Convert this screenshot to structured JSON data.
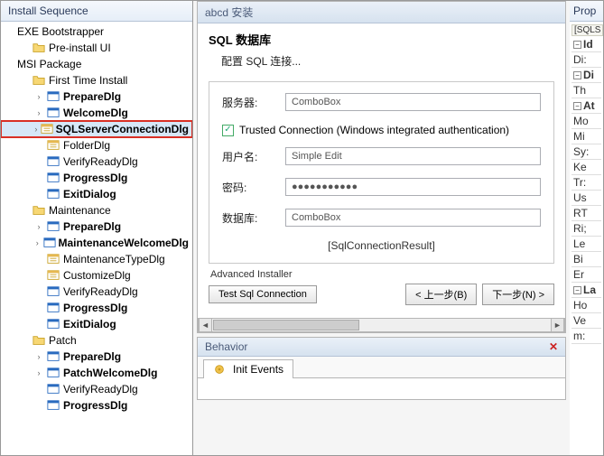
{
  "left": {
    "title": "Install Sequence",
    "tree": [
      {
        "d": 0,
        "exp": "",
        "icon": "root",
        "label": "EXE Bootstrapper",
        "bold": false
      },
      {
        "d": 1,
        "exp": "",
        "icon": "folder",
        "label": "Pre-install UI",
        "bold": false
      },
      {
        "d": 0,
        "exp": "",
        "icon": "root",
        "label": "MSI Package",
        "bold": false
      },
      {
        "d": 1,
        "exp": "",
        "icon": "folder",
        "label": "First Time Install",
        "bold": false
      },
      {
        "d": 2,
        "exp": "›",
        "icon": "dlg",
        "label": "PrepareDlg",
        "bold": true
      },
      {
        "d": 2,
        "exp": "›",
        "icon": "dlg",
        "label": "WelcomeDlg",
        "bold": true
      },
      {
        "d": 2,
        "exp": "›",
        "icon": "dlgf",
        "label": "SQLServerConnectionDlg",
        "bold": true,
        "hl": true
      },
      {
        "d": 2,
        "exp": "",
        "icon": "dlgf",
        "label": "FolderDlg",
        "bold": false
      },
      {
        "d": 2,
        "exp": "",
        "icon": "dlg",
        "label": "VerifyReadyDlg",
        "bold": false
      },
      {
        "d": 2,
        "exp": "",
        "icon": "dlg",
        "label": "ProgressDlg",
        "bold": true
      },
      {
        "d": 2,
        "exp": "",
        "icon": "dlg",
        "label": "ExitDialog",
        "bold": true
      },
      {
        "d": 1,
        "exp": "",
        "icon": "folder",
        "label": "Maintenance",
        "bold": false
      },
      {
        "d": 2,
        "exp": "›",
        "icon": "dlg",
        "label": "PrepareDlg",
        "bold": true
      },
      {
        "d": 2,
        "exp": "›",
        "icon": "dlg",
        "label": "MaintenanceWelcomeDlg",
        "bold": true
      },
      {
        "d": 2,
        "exp": "",
        "icon": "dlgf",
        "label": "MaintenanceTypeDlg",
        "bold": false
      },
      {
        "d": 2,
        "exp": "",
        "icon": "dlgf",
        "label": "CustomizeDlg",
        "bold": false
      },
      {
        "d": 2,
        "exp": "",
        "icon": "dlg",
        "label": "VerifyReadyDlg",
        "bold": false
      },
      {
        "d": 2,
        "exp": "",
        "icon": "dlg",
        "label": "ProgressDlg",
        "bold": true
      },
      {
        "d": 2,
        "exp": "",
        "icon": "dlg",
        "label": "ExitDialog",
        "bold": true
      },
      {
        "d": 1,
        "exp": "",
        "icon": "folder",
        "label": "Patch",
        "bold": false
      },
      {
        "d": 2,
        "exp": "›",
        "icon": "dlg",
        "label": "PrepareDlg",
        "bold": true
      },
      {
        "d": 2,
        "exp": "›",
        "icon": "dlg",
        "label": "PatchWelcomeDlg",
        "bold": true
      },
      {
        "d": 2,
        "exp": "",
        "icon": "dlg",
        "label": "VerifyReadyDlg",
        "bold": false
      },
      {
        "d": 2,
        "exp": "",
        "icon": "dlg",
        "label": "ProgressDlg",
        "bold": true
      }
    ]
  },
  "preview": {
    "windowTitle": "abcd 安装",
    "heading": "SQL 数据库",
    "subheading": "配置 SQL 连接...",
    "labels": {
      "server": "服务器:",
      "trusted": "Trusted Connection (Windows integrated authentication)",
      "user": "用户名:",
      "pass": "密码:",
      "database": "数据库:"
    },
    "controls": {
      "serverCtl": "ComboBox",
      "userCtl": "Simple Edit",
      "passCtl": "●●●●●●●●●●●",
      "dbCtl": "ComboBox",
      "result": "[SqlConnectionResult]"
    },
    "advanced": "Advanced Installer",
    "buttons": {
      "test": "Test Sql Connection",
      "back": "< 上一步(B)",
      "next": "下一步(N) >"
    }
  },
  "behavior": {
    "title": "Behavior",
    "tab": "Init Events"
  },
  "right": {
    "title": "Prop",
    "tag": "[SQLS",
    "cats": [
      "Id",
      "Di",
      "At",
      "La"
    ],
    "rows": [
      "Di:",
      "Th",
      "Mo",
      "Mi",
      "Sy:",
      "Ke",
      "Tr:",
      "Us",
      "RT",
      "Ri;",
      "Le",
      "Bi",
      "Er",
      "Ho",
      "Ve",
      "m:"
    ]
  }
}
